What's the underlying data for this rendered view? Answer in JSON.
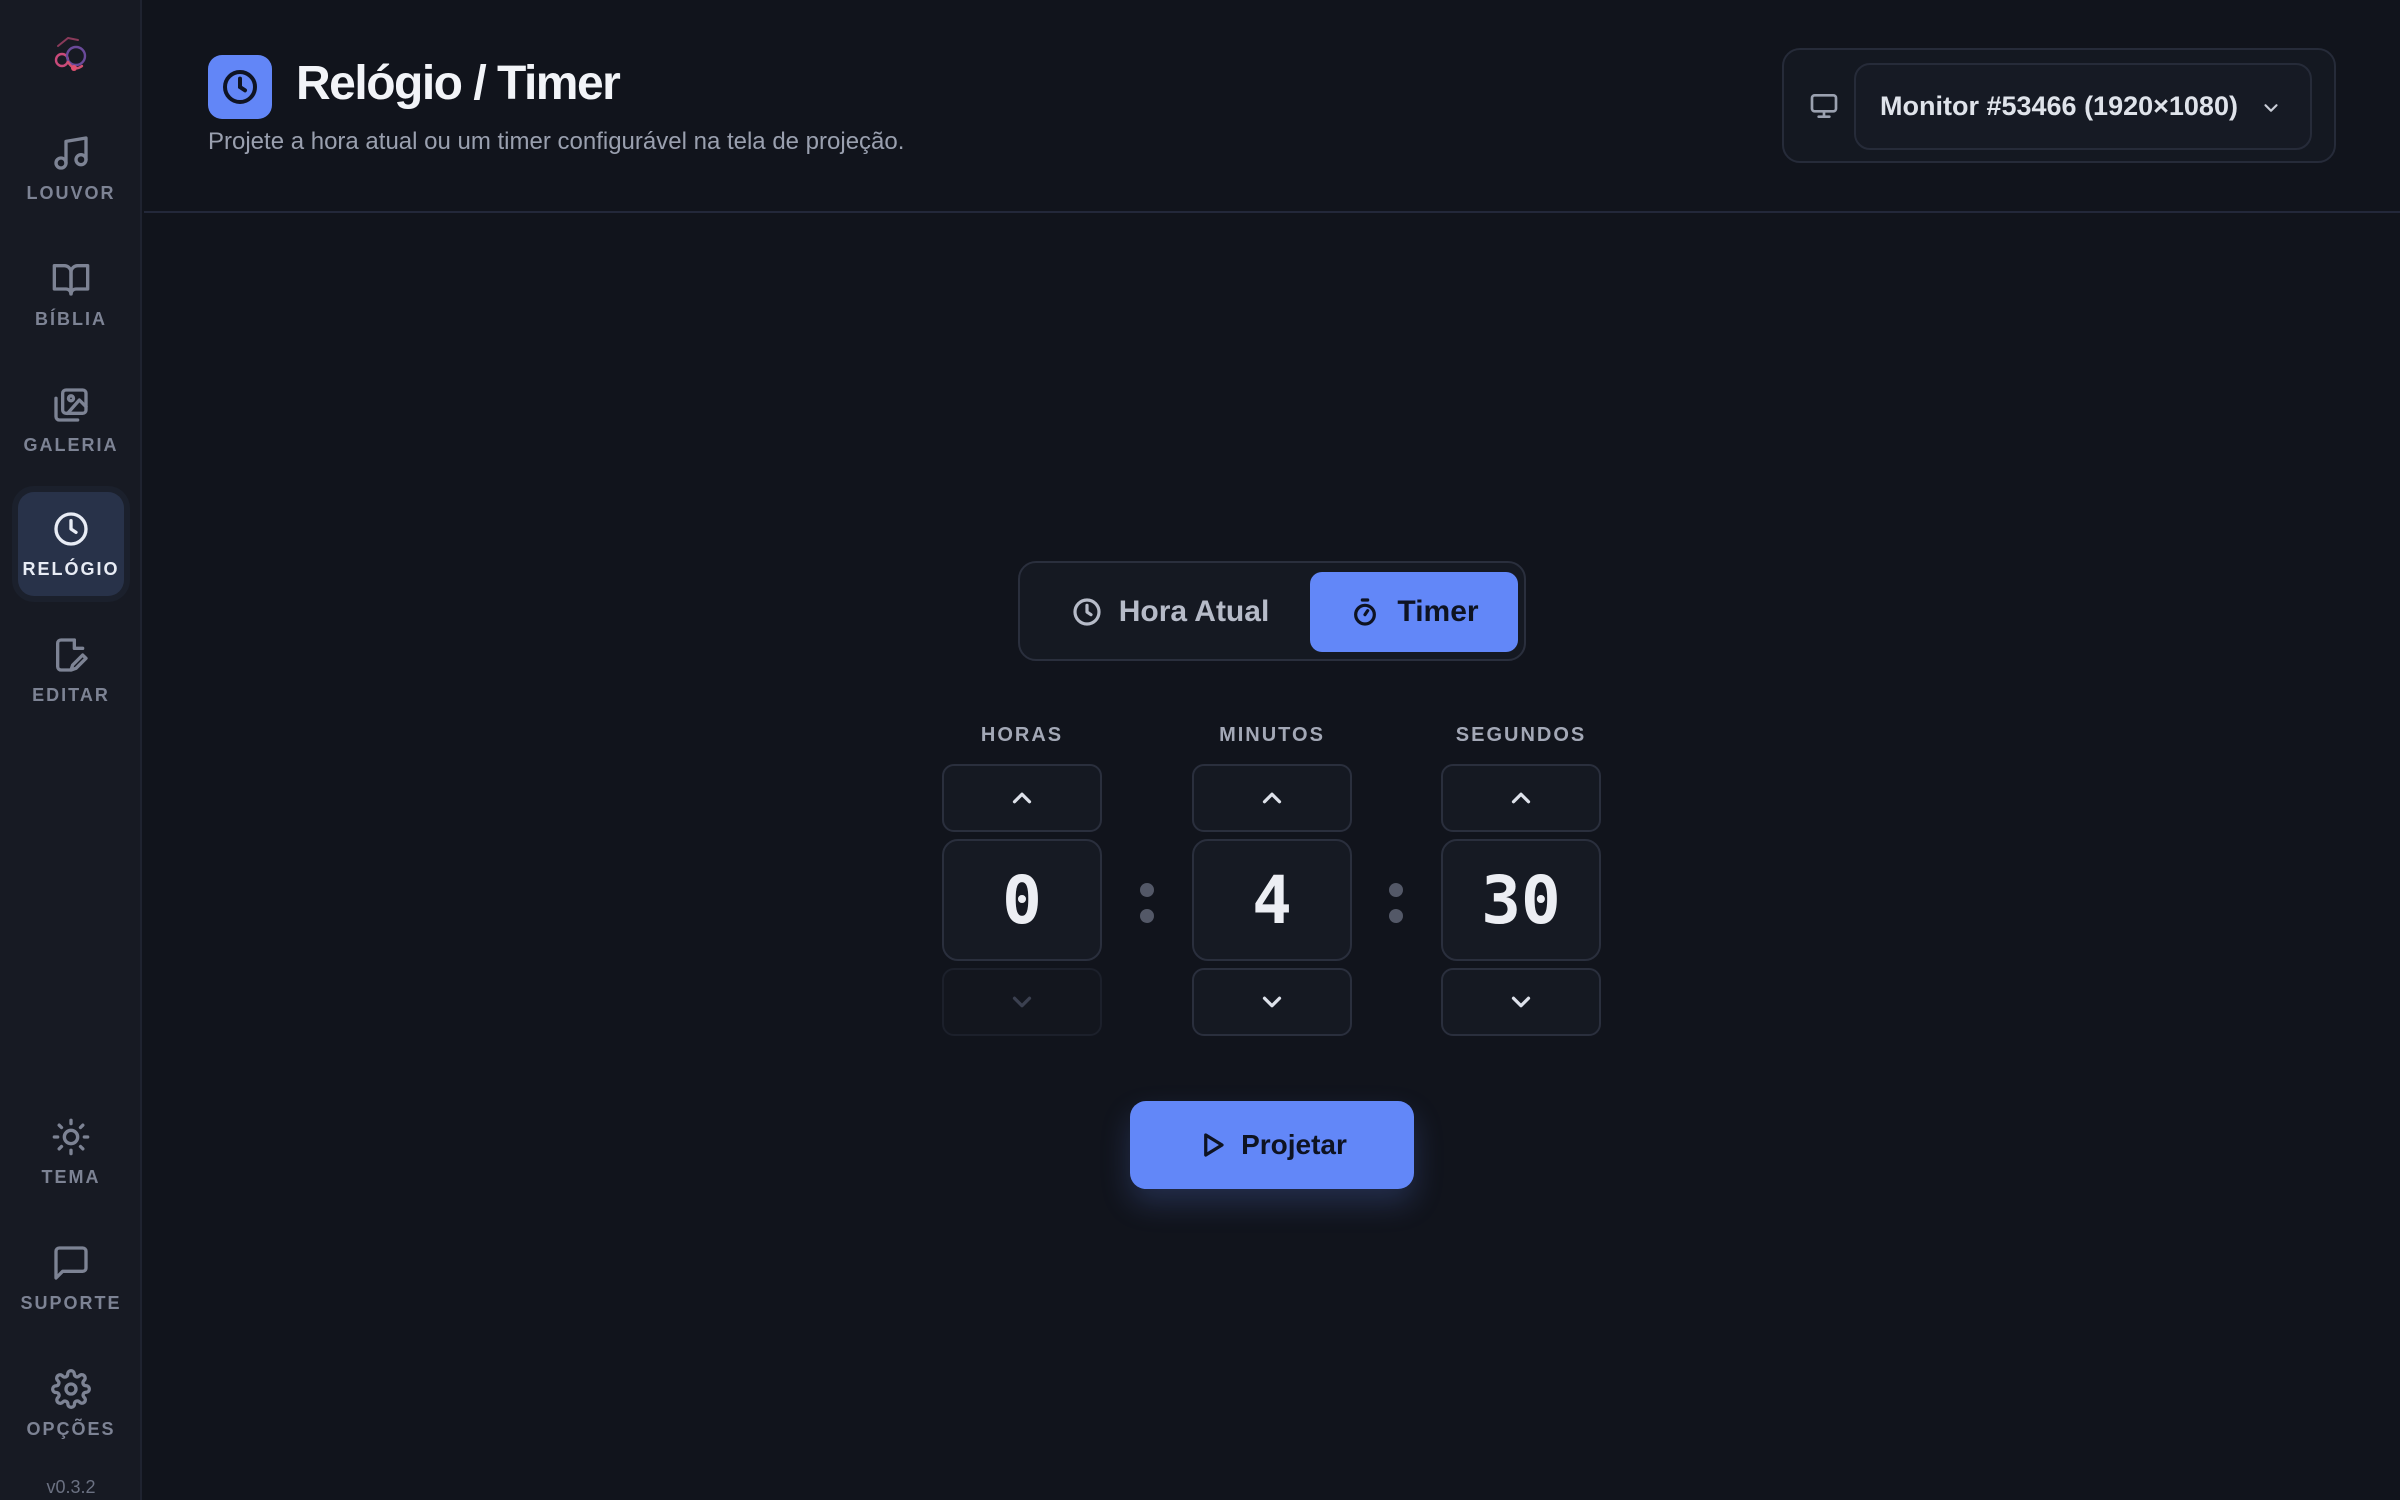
{
  "app": {
    "version": "v0.3.2",
    "accent_color": "#6287f8"
  },
  "sidebar": {
    "items": [
      {
        "label": "LOUVOR",
        "icon": "music-note-icon"
      },
      {
        "label": "BÍBLIA",
        "icon": "book-open-icon"
      },
      {
        "label": "GALERIA",
        "icon": "images-icon"
      },
      {
        "label": "RELÓGIO",
        "icon": "clock-icon",
        "active": true
      },
      {
        "label": "EDITAR",
        "icon": "file-edit-icon"
      }
    ],
    "bottom_items": [
      {
        "label": "TEMA",
        "icon": "sun-icon"
      },
      {
        "label": "SUPORTE",
        "icon": "message-square-icon"
      },
      {
        "label": "OPÇÕES",
        "icon": "gear-icon"
      }
    ]
  },
  "header": {
    "title": "Relógio / Timer",
    "subtitle": "Projete a hora atual ou um timer configurável na tela de projeção.",
    "monitor_select": "Monitor #53466 (1920×1080)"
  },
  "mode_toggle": {
    "clock_label": "Hora Atual",
    "timer_label": "Timer",
    "selected": "Timer"
  },
  "timer": {
    "hours_label": "HORAS",
    "minutes_label": "MINUTOS",
    "seconds_label": "SEGUNDOS",
    "hours": "0",
    "minutes": "4",
    "seconds": "30"
  },
  "actions": {
    "project_label": "Projetar"
  }
}
